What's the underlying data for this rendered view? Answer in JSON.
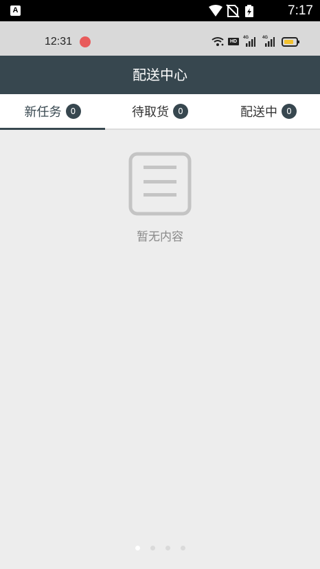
{
  "system_bar": {
    "time": "7:17",
    "app_icon_letter": "A",
    "icons": [
      "wifi-icon",
      "no-sim-icon",
      "battery-charging-icon"
    ]
  },
  "inner_status_bar": {
    "time": "12:31",
    "hd_label": "HD",
    "signal_labels": [
      "4G",
      "4G"
    ],
    "icons": [
      "app-notification-icon",
      "wifi-icon",
      "signal-icon",
      "battery-icon"
    ]
  },
  "header": {
    "title": "配送中心"
  },
  "tabs": [
    {
      "label": "新任务",
      "count": "0",
      "active": true
    },
    {
      "label": "待取货",
      "count": "0",
      "active": false
    },
    {
      "label": "配送中",
      "count": "0",
      "active": false
    }
  ],
  "empty_state": {
    "icon": "document-list-icon",
    "text": "暂无内容"
  },
  "pager": {
    "total": 4,
    "active_index": 0
  },
  "colors": {
    "header_bg": "#37474f",
    "badge_bg": "#37474f",
    "page_bg": "#ededed"
  }
}
